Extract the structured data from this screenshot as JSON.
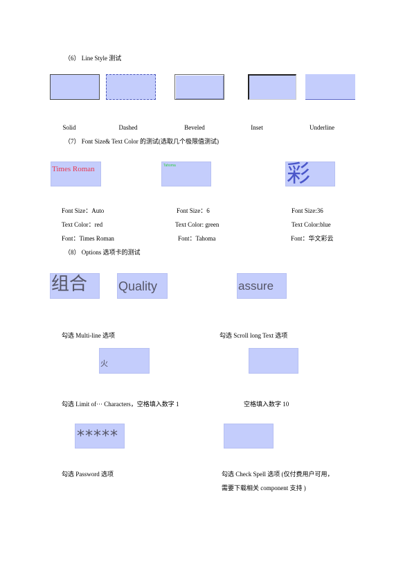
{
  "section6": {
    "heading": "（6）  Line Style 测试",
    "labels": [
      "Solid",
      "Dashed",
      "Beveled",
      "Inset",
      "Underline"
    ]
  },
  "section7": {
    "heading": "（7）  Font Size& Text Color 的测试(选取几个极限值测试)",
    "box_texts": [
      "Times Roman",
      "Tahoma",
      "彩"
    ],
    "col1": [
      "Font Size：Auto",
      "Text Color：red",
      "Font：Times Roman"
    ],
    "col2": [
      "Font Size：6",
      "Text Color: green",
      "Font：Tahoma"
    ],
    "col3": [
      "Font Size:36",
      "Text Color:blue",
      "Font：华文彩云"
    ],
    "colors": {
      "red": "#e8384f",
      "green": "#2ecc40",
      "blue": "#4a56c9"
    }
  },
  "section8": {
    "heading": "（8）  Options 选项卡的测试",
    "box_texts": [
      "组合",
      "Quality",
      "assure",
      "火",
      "*****"
    ],
    "labels": {
      "multiline": "勾选 Multi-line 选项",
      "scroll": "勾选 Scroll long Text 选项",
      "limit": "勾选 Limit of··· Characters，空格填入数字 1",
      "limit10": "空格填入数字 10",
      "password": "勾选 Password 选项",
      "checkspell_1": "勾选 Check Spell 选项 (仅付费用户可用，",
      "checkspell_2": "需要下载相关 component 支持 )"
    }
  },
  "colors": {
    "field_fill": "#c4cdfc",
    "field_text": "#555566"
  }
}
